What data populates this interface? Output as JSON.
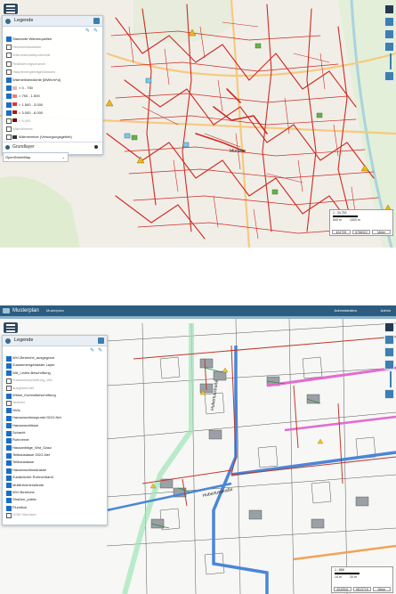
{
  "screenshot1": {
    "legend": {
      "title": "Legende",
      "items": [
        {
          "label": "Standorte Wärmequellen",
          "checked": true,
          "grey": false
        },
        {
          "label": "Heizwerkskataster",
          "checked": false,
          "grey": true
        },
        {
          "label": "Wärmebedarfspotenzial",
          "checked": false,
          "grey": true
        },
        {
          "label": "Realisierungschance",
          "checked": false,
          "grey": true
        },
        {
          "label": "Hauptenergieträgerklassen",
          "checked": false,
          "grey": true
        },
        {
          "label": "Wärmeliniendichte [MWh/m*a]",
          "checked": true,
          "grey": false
        },
        {
          "label": "< 0 - 750",
          "checked": true,
          "grey": false,
          "swatch": "#f5b3ad"
        },
        {
          "label": "> 750 - 1.500",
          "checked": true,
          "grey": false,
          "swatch": "#ef7e74"
        },
        {
          "label": "> 1.500 - 3.000",
          "checked": true,
          "grey": false,
          "swatch": "#dd3b2f"
        },
        {
          "label": "> 3.000 - 6.000",
          "checked": true,
          "grey": false,
          "swatch": "#a81c14"
        },
        {
          "label": "> 6.000",
          "checked": false,
          "grey": true,
          "swatch": "#6b0a05"
        },
        {
          "label": "Wärmenetze",
          "checked": false,
          "grey": true
        },
        {
          "label": "Wärmenetze (Versorgungsgebiet)",
          "checked": false,
          "grey": false,
          "swatch": "#333333"
        }
      ]
    },
    "grundlayer": {
      "title": "Grundlayer",
      "selected": "OpenStreetMap"
    },
    "map_label": "Münster",
    "scale": {
      "ratio": "1 : 34.752",
      "dist1": "500 m",
      "dist2": "1000 m",
      "cell1": "404739",
      "cell2": "5756922",
      "cell3": "Meter"
    }
  },
  "screenshot2": {
    "topbar": {
      "app": "Musterplan",
      "sub": "Musterplan",
      "admin": "Administration",
      "user": "Admin"
    },
    "legend": {
      "title": "Legende",
      "items": [
        {
          "label": "WVI-Bereiche_ausgegraut",
          "checked": true,
          "grey": false
        },
        {
          "label": "Zusammengefasster Layer",
          "checked": true,
          "grey": false
        },
        {
          "label": "WA_Linien-Beschriftung",
          "checked": true,
          "grey": false
        },
        {
          "label": "Trassenbeschriftung_WA",
          "checked": false,
          "grey": true
        },
        {
          "label": "ausgeblendet",
          "checked": false,
          "grey": true
        },
        {
          "label": "Wirkel_Kontrollbeschriftung",
          "checked": true,
          "grey": false
        },
        {
          "label": "Textfeld",
          "checked": false,
          "grey": true
        },
        {
          "label": "NVts",
          "checked": true,
          "grey": false
        },
        {
          "label": "Hausanschlusspunkt GDO-Net",
          "checked": true,
          "grey": false
        },
        {
          "label": "Hausanschlüsse",
          "checked": true,
          "grey": false
        },
        {
          "label": "Schacht",
          "checked": true,
          "grey": false
        },
        {
          "label": "Rohrverde",
          "checked": true,
          "grey": false
        },
        {
          "label": "Hausanträge_Wst_Gaso",
          "checked": true,
          "grey": false
        },
        {
          "label": "Teilbaustasse GDO-Net",
          "checked": true,
          "grey": false
        },
        {
          "label": "Teilbaustasse",
          "checked": true,
          "grey": false
        },
        {
          "label": "Hausanschlusstrasse",
          "checked": true,
          "grey": false
        },
        {
          "label": "Zusätzlicher Rohrverband",
          "checked": true,
          "grey": false
        },
        {
          "label": "Multiinformerstände",
          "checked": true,
          "grey": false
        },
        {
          "label": "WVI-Bereiche",
          "checked": true,
          "grey": false
        },
        {
          "label": "Straßen_public",
          "checked": true,
          "grey": false
        },
        {
          "label": "Flurstück",
          "checked": true,
          "grey": false
        },
        {
          "label": "OSM Standard",
          "checked": false,
          "grey": true
        }
      ]
    },
    "street1": "Hubertusstraße",
    "street2": "Hubertusstraße",
    "scale": {
      "ratio": "1 : 888",
      "dist1": "10 m",
      "dist2": "20 m",
      "cell1": "4043941",
      "cell2": "5813715",
      "cell3": "Meter"
    }
  }
}
